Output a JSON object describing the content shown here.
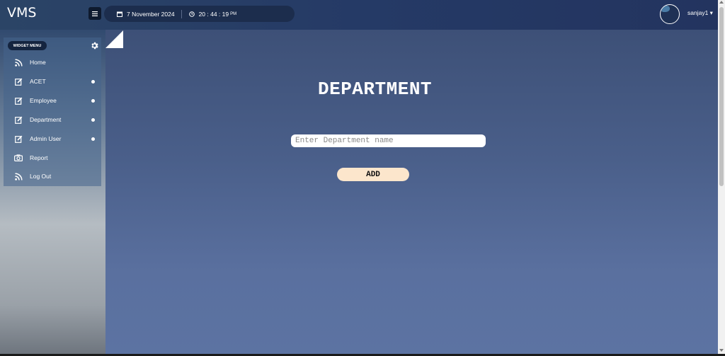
{
  "app": {
    "title": "VMS"
  },
  "header": {
    "menu_toggle_icon": "hamburger-icon",
    "date": "7 November 2024",
    "time": "20 : 44 : 19",
    "ampm": "PM",
    "user": "sanjay1 ▾"
  },
  "sidebar": {
    "widget_label": "WIDGET MENU",
    "items": [
      {
        "label": "Home",
        "icon": "rss-icon",
        "dot": false
      },
      {
        "label": "ACET",
        "icon": "edit-icon",
        "dot": true
      },
      {
        "label": "Employee",
        "icon": "edit-icon",
        "dot": true
      },
      {
        "label": "Department",
        "icon": "edit-icon",
        "dot": true
      },
      {
        "label": "Admin User",
        "icon": "edit-icon",
        "dot": true
      },
      {
        "label": "Report",
        "icon": "camera-icon",
        "dot": false
      },
      {
        "label": "Log Out",
        "icon": "rss-icon",
        "dot": false
      }
    ]
  },
  "main": {
    "title": "DEPARTMENT",
    "input_placeholder": "Enter Department name",
    "input_value": "",
    "add_label": "ADD"
  },
  "colors": {
    "topbar": "#253a66",
    "main_bg": "#4a5f8a",
    "add_button": "#fce6cc",
    "pill": "#1c2d4d"
  }
}
